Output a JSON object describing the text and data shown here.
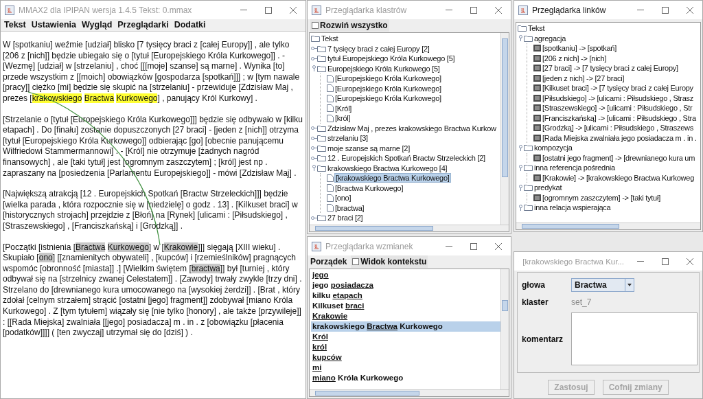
{
  "main_window": {
    "title": "MMAX2 dla IPIPAN wersja 1.4.5 Tekst: 0.mmax",
    "active": false,
    "menu": [
      "Tekst",
      "Ustawienia",
      "Wygląd",
      "Przeglądarki",
      "Dodatki"
    ],
    "paragraphs": [
      [
        {
          "text": "W [spotkaniu] weźmie [udział] blisko [7 tysięcy braci z [całej Europy]] , ale tylko [206 z [nich]] będzie ubiegało się o [tytuł [Europejskiego Króla Kurkowego]] . - [Wezmę] [udział] w [strzelaniu] , choć [[[moje] szanse] są marne] . Wynika [to] przede wszystkim z [[moich] obowiązków [gospodarza [spotkań]]] ; w [tym nawale [pracy]] ciężko [mi] będzie się skupić na [strzelaniu] - przewiduje [Zdzisław Maj , prezes ["
        },
        {
          "text": "krakowskiego Bractwa Kurkowego",
          "color": "#ffff33"
        },
        {
          "text": "] , panujący Król Kurkowy] ."
        }
      ],
      [
        {
          "text": "[Strzelanie o [tytuł [Europejskiego Króla Kurkowego]]] będzie się odbywało w [kilku etapach] . Do [finału] zostanie dopuszczonych [27 braci] - [jeden z [nich]] otrzyma [tytuł [Europejskiego Króla Kurkowego]] odbierając [go] [obecnie panującemu Wilfriedowi Stammermannowi] . - [Król] nie otrzymuje [żadnych nagród finansowych] , ale [taki tytuł] jest [ogromnym zaszczytem] ; [król] jest np . zapraszany na [posiedzenia [Parlamentu Europejskiego]] - mówi [Zdzisław Maj] ."
        }
      ],
      [
        {
          "text": "[Największą atrakcją [12 . Europejskich Spotkań [Bractw Strzeleckich]]] będzie [wielka parada , która rozpocznie się w [niedzielę] o godz . 13] . [Kilkuset braci] w [historycznych strojach] przejdzie z [Błoń] na [Rynek] [ulicami : [Piłsudskiego] , [Straszewskiego] , [Franciszkańską] i [Grodzką]] ."
        }
      ],
      [
        {
          "text": "[Początki [istnienia ["
        },
        {
          "text": "Bractwa Kurkowego",
          "color": "#c8c8c8"
        },
        {
          "text": "] w ["
        },
        {
          "text": "Krakowie",
          "color": "#c8c8c8"
        },
        {
          "text": "]]] sięgają [XIII wieku] . Skupiało ["
        },
        {
          "text": "ono",
          "color": "#c8c8c8"
        },
        {
          "text": "] [[znamienitych obywateli] , [kupców] i [rzemieślników] pragnących wspomóc [obronność [miasta]] .] [Wielkim świętem ["
        },
        {
          "text": "bractwa",
          "color": "#c8c8c8"
        },
        {
          "text": "]] był [turniej , który odbywał się na [strzelnicy zwanej Celestatem]] . [Zawody] trwały zwykle [trzy dni] . Strzelano do [drewnianego kura umocowanego na [wysokiej żerdzi]] . [Brat , który zdołał [celnym strzałem] strącić [ostatni [jego] fragment]] zdobywał [miano Króla Kurkowego] . Z [tym tytułem] wiązały się [nie tylko [honory] , ale także [przywileje]] : [[Rada Miejska] zwalniała [[jego] posiadacza] m . in . z [obowiązku [płacenia [podatków]]]] ( [ten zwyczaj] utrzymał się do [dziś] ) ."
        }
      ]
    ]
  },
  "cluster_browser": {
    "title": "Przeglądarka klastrów",
    "active": false,
    "expand_all": {
      "label": "Rozwiń wszystko",
      "checked": false
    },
    "tree": {
      "label": "Tekst",
      "kind": "folder",
      "selected": false,
      "children": [
        {
          "label": "7 tysięcy braci z całej Europy [2]",
          "kind": "folder",
          "expanded": false,
          "selected": false
        },
        {
          "label": "tytuł Europejskiego Króla Kurkowego [5]",
          "kind": "folder",
          "expanded": false,
          "selected": false
        },
        {
          "label": "Europejskiego Króla Kurkowego [5]",
          "kind": "folder",
          "expanded": true,
          "selected": false,
          "children": [
            {
              "label": "[Europejskiego Króla Kurkowego]",
              "kind": "file",
              "selected": false
            },
            {
              "label": "[Europejskiego Króla Kurkowego]",
              "kind": "file",
              "selected": false
            },
            {
              "label": "[Europejskiego Króla Kurkowego]",
              "kind": "file",
              "selected": false
            },
            {
              "label": "[Król]",
              "kind": "file",
              "selected": false
            },
            {
              "label": "[król]",
              "kind": "file",
              "selected": false
            }
          ]
        },
        {
          "label": "Zdzisław Maj , prezes krakowskiego Bractwa Kurkow",
          "kind": "folder",
          "expanded": false,
          "selected": false
        },
        {
          "label": "strzelaniu [3]",
          "kind": "folder",
          "expanded": false,
          "selected": false
        },
        {
          "label": "moje szanse są marne [2]",
          "kind": "folder",
          "expanded": false,
          "selected": false
        },
        {
          "label": "12 . Europejskich Spotkań Bractw Strzeleckich [2]",
          "kind": "folder",
          "expanded": false,
          "selected": false
        },
        {
          "label": "krakowskiego Bractwa Kurkowego [4]",
          "kind": "folder",
          "expanded": true,
          "selected": false,
          "children": [
            {
              "label": "[krakowskiego Bractwa Kurkowego]",
              "kind": "file",
              "selected": true
            },
            {
              "label": "[Bractwa Kurkowego]",
              "kind": "file",
              "selected": false
            },
            {
              "label": "[ono]",
              "kind": "file",
              "selected": false
            },
            {
              "label": "[bractwa]",
              "kind": "file",
              "selected": false
            }
          ]
        },
        {
          "label": "27 braci [2]",
          "kind": "folder",
          "expanded": false,
          "selected": false
        }
      ]
    }
  },
  "link_browser": {
    "title": "Przeglądarka linków",
    "active": true,
    "tree": {
      "label": "Tekst",
      "kind": "folder",
      "selected": false,
      "children": [
        {
          "label": "agregacja",
          "kind": "folder",
          "expanded": true,
          "selected": false,
          "children": [
            {
              "label": "[spotkaniu] -> [spotkań]",
              "kind": "link",
              "selected": false
            },
            {
              "label": "[206 z nich] -> [nich]",
              "kind": "link",
              "selected": false
            },
            {
              "label": "[27 braci] -> [7 tysięcy braci z całej Europy]",
              "kind": "link",
              "selected": false
            },
            {
              "label": "[jeden z nich] -> [27 braci]",
              "kind": "link",
              "selected": false
            },
            {
              "label": "[Kilkuset braci] -> [7 tysięcy braci z całej Europy",
              "kind": "link",
              "selected": false
            },
            {
              "label": "[Piłsudskiego] -> [ulicami : Piłsudskiego , Strasz",
              "kind": "link",
              "selected": false
            },
            {
              "label": "[Straszewskiego] -> [ulicami : Piłsudskiego , Str",
              "kind": "link",
              "selected": false
            },
            {
              "label": "[Franciszkańską] -> [ulicami : Piłsudskiego , Stra",
              "kind": "link",
              "selected": false
            },
            {
              "label": "[Grodzką] -> [ulicami : Piłsudskiego , Straszews",
              "kind": "link",
              "selected": false
            },
            {
              "label": "[Rada Miejska zwalniała jego posiadacza m . in .",
              "kind": "link",
              "selected": false
            }
          ]
        },
        {
          "label": "kompozycja",
          "kind": "folder",
          "expanded": true,
          "selected": false,
          "children": [
            {
              "label": "[ostatni jego fragment] -> [drewnianego kura um",
              "kind": "link",
              "selected": false
            }
          ]
        },
        {
          "label": "inna referencja pośrednia",
          "kind": "folder",
          "expanded": true,
          "selected": false,
          "children": [
            {
              "label": "[Krakowie] -> [krakowskiego Bractwa Kurkoweg",
              "kind": "link",
              "selected": false
            }
          ]
        },
        {
          "label": "predykat",
          "kind": "folder",
          "expanded": true,
          "selected": false,
          "children": [
            {
              "label": "[ogromnym zaszczytem] -> [taki tytuł]",
              "kind": "link",
              "selected": false
            }
          ]
        },
        {
          "label": "inna relacja wspierająca",
          "kind": "folder",
          "expanded": true,
          "selected": false
        }
      ]
    }
  },
  "mention_browser": {
    "title": "Przeglądarka wzmianek",
    "active": false,
    "order_menu": "Porządek",
    "context_view": {
      "label": "Widok kontekstu",
      "checked": false
    },
    "items": [
      {
        "selected": false,
        "words": [
          {
            "text": "jego",
            "underlined": true
          }
        ]
      },
      {
        "selected": false,
        "words": [
          {
            "text": "jego ",
            "underlined": false
          },
          {
            "text": "posiadacza",
            "underlined": true
          }
        ]
      },
      {
        "selected": false,
        "words": [
          {
            "text": "kilku ",
            "underlined": false
          },
          {
            "text": "etapach",
            "underlined": true
          }
        ]
      },
      {
        "selected": false,
        "words": [
          {
            "text": "Kilkuset ",
            "underlined": false
          },
          {
            "text": "braci",
            "underlined": true
          }
        ]
      },
      {
        "selected": false,
        "words": [
          {
            "text": "Krakowie",
            "underlined": true
          }
        ]
      },
      {
        "selected": true,
        "words": [
          {
            "text": "krakowskiego ",
            "underlined": false
          },
          {
            "text": "Bractwa",
            "underlined": true
          },
          {
            "text": " Kurkowego",
            "underlined": false
          }
        ]
      },
      {
        "selected": false,
        "words": [
          {
            "text": "Król",
            "underlined": true
          }
        ]
      },
      {
        "selected": false,
        "words": [
          {
            "text": "król",
            "underlined": true
          }
        ]
      },
      {
        "selected": false,
        "words": [
          {
            "text": "kupców",
            "underlined": true
          }
        ]
      },
      {
        "selected": false,
        "words": [
          {
            "text": "mi",
            "underlined": true
          }
        ]
      },
      {
        "selected": false,
        "words": [
          {
            "text": "miano",
            "underlined": true
          },
          {
            "text": " Króla Kurkowego",
            "underlined": false
          }
        ]
      }
    ]
  },
  "mention_dialog": {
    "title": "[krakowskiego Bractwa Kur...",
    "active": false,
    "fields": [
      {
        "label": "głowa",
        "kind": "dropdown",
        "value": "Bractwa"
      },
      {
        "label": "klaster",
        "kind": "text",
        "value": "set_7"
      },
      {
        "label": "komentarz",
        "kind": "textarea"
      }
    ],
    "buttons": [
      {
        "label": "Zastosuj",
        "disabled": true
      },
      {
        "label": "Cofnij zmiany",
        "disabled": true
      }
    ]
  }
}
